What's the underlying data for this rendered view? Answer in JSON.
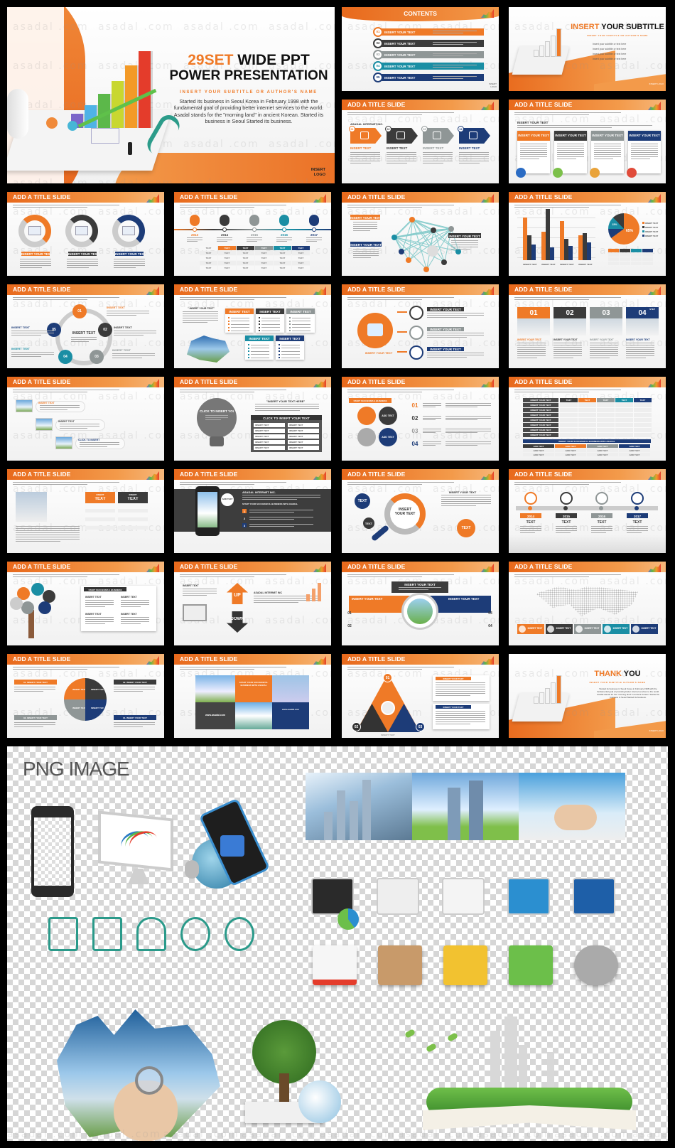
{
  "colors": {
    "orange": "#ef7a27",
    "dark": "#3b3b3b",
    "grey": "#8f9696",
    "teal": "#1a8ea4",
    "navy": "#1d3c78"
  },
  "watermark": "asadal .com",
  "hero": {
    "title_accent": "29SET",
    "title_rest": "WIDE PPT",
    "title_line2": "POWER PRESENTATION",
    "subtitle": "INSERT YOUR SUBTITLE OR AUTHOR'S NAME",
    "body": "Started its business in Seoul Korea in February 1998 with the fundamental goal of providing better internet services to the world. Asadal stands for the \"morning land\" in ancient Korean. Started its business in Seoul Started its business.",
    "logo": "INSERT LOGO"
  },
  "contents": {
    "title": "CONTENTS",
    "items": [
      {
        "num": "01",
        "label": "INSERT YOUR TEXT"
      },
      {
        "num": "02",
        "label": "INSERT YOUR TEXT"
      },
      {
        "num": "03",
        "label": "INSERT YOUR TEXT"
      },
      {
        "num": "04",
        "label": "INSERT YOUR TEXT"
      },
      {
        "num": "05",
        "label": "INSERT YOUR TEXT"
      }
    ],
    "logo": "INSERT LOGO"
  },
  "subtitle_slide": {
    "title_accent": "INSERT",
    "title_rest": "YOUR SUBTITLE",
    "subtitle": "INSERT YOUR SUBTITLE OR AUTHOR'S NAME",
    "bullets": [
      "Insert your subtitle or text here",
      "Insert your subtitle or text here",
      "Insert your subtitle or text here",
      "Insert your subtitle or text here"
    ],
    "logo": "INSERT LOGO"
  },
  "thanks": {
    "title_accent": "THANK",
    "title_rest": "YOU",
    "subtitle": "INSERT YOUR SUBTITLE AUTHOR'S NAME",
    "body": "Started its business in Seoul Korea in February 1998 with the fundamental goal of providing better internet services to the world. Asadal stands for the \"morning land\" in ancient Korean. Started its business in Seoul Started its business.",
    "logo": "INSERT LOGO"
  },
  "slides": [
    {
      "title": "ADD A TITLE SLIDE",
      "variant": "arrows4",
      "labels": [
        "ASADAL INTERNET,INC.",
        "INSERT TEXT",
        "INSERT TEXT",
        "INSERT TEXT",
        "INSERT TEXT",
        "01",
        "02",
        "03",
        "04"
      ]
    },
    {
      "title": "ADD A TITLE SLIDE",
      "variant": "cards4",
      "labels": [
        "INSERT YOUR TEXT",
        "INSERT YOUR TEXT",
        "INSERT YOUR TEXT",
        "INSERT YOUR TEXT",
        "INSERT YOUR TEXT"
      ]
    },
    {
      "title": "ADD A TITLE SLIDE",
      "variant": "donuts3",
      "labels": [
        "INSERT YOUR TEXT",
        "INSERT YOUR TEXT",
        "INSERT YOUR TEXT"
      ]
    },
    {
      "title": "ADD A TITLE SLIDE",
      "variant": "timeline",
      "labels": [
        "2013",
        "2014",
        "2015",
        "2016",
        "2017",
        "TEXT"
      ]
    },
    {
      "title": "ADD A TITLE SLIDE",
      "variant": "network",
      "labels": [
        "INSERT YOUR TEXT",
        "INSERT YOUR TEXT",
        "INSERT YOUR TEXT"
      ]
    },
    {
      "title": "ADD A TITLE SLIDE",
      "variant": "barpie",
      "labels": [
        "INSERT TEXT",
        "INSERT TEXT",
        "INSERT TEXT",
        "INSERT TEXT",
        "65%",
        "15%",
        "INSERT TEXT"
      ]
    },
    {
      "title": "ADD A TITLE SLIDE",
      "variant": "cycle",
      "labels": [
        "INSERT TEXT",
        "01",
        "02",
        "03",
        "04",
        "05",
        "INSERT TEXT"
      ]
    },
    {
      "title": "ADD A TITLE SLIDE",
      "variant": "lists",
      "labels": [
        "INSERT TEXT",
        "INSERT TEXT",
        "INSERT TEXT",
        "INSERT TEXT",
        "INSERT TEXT",
        "\" INSERT YOUR TEXT\"",
        "INSERT YOUR TEXT"
      ]
    },
    {
      "title": "ADD A TITLE SLIDE",
      "variant": "hub",
      "labels": [
        "INSERT YOUR TEXT",
        "INSERT YOUR TEXT",
        "INSERT YOUR TEXT",
        "INSERT YOUR TEXT"
      ]
    },
    {
      "title": "ADD A TITLE SLIDE",
      "variant": "photos4",
      "labels": [
        "01",
        "02",
        "03",
        "04",
        "STEP",
        "INSERT YOUR TEXT"
      ]
    },
    {
      "title": "ADD A TITLE SLIDE",
      "variant": "imglist",
      "labels": [
        "INSERT TEXT",
        "INSERT TEXT",
        "CLICK TO INSERT"
      ]
    },
    {
      "title": "ADD A TITLE SLIDE",
      "variant": "bulb",
      "labels": [
        "CLICK TO INSERT YOUR TEXT",
        "\"INSERT YOUR TEXT HERE\"",
        "CLICK TO INSERT YOUR TEXT",
        "INSERT TEXT"
      ]
    },
    {
      "title": "ADD A TITLE SLIDE",
      "variant": "steps4",
      "labels": [
        "START SUCCESSFUL BUSINESS",
        "01",
        "02",
        "03",
        "04",
        "ADD TEXT",
        "ADD TEXT"
      ]
    },
    {
      "title": "ADD A TITLE SLIDE",
      "variant": "table",
      "labels": [
        "INSERT YOUR TEXT",
        "TEXT",
        "INSERT YOUR SUCCESSFUL BUSINESS WITH ASADAL",
        "ADD TEXT"
      ]
    },
    {
      "title": "ADD A TITLE SLIDE",
      "variant": "phototext",
      "labels": [
        "TEXT",
        "TEXT",
        "INSERT",
        "TEXT"
      ]
    },
    {
      "title": "ADD A TITLE SLIDE",
      "variant": "phone",
      "labels": [
        "ASADAL INTERNET INC.",
        "START YOUR SUCCESSFUL BUSINESS WITH ASADAL",
        "ADD TEXT",
        "1",
        "2",
        "3"
      ]
    },
    {
      "title": "ADD A TITLE SLIDE",
      "variant": "magnifier",
      "labels": [
        "INSERT YOUR TEXT",
        "INSERT YOUR TEXT",
        "TEXT",
        "TEXT",
        "INSERT YOUR TEXT"
      ]
    },
    {
      "title": "ADD A TITLE SLIDE",
      "variant": "timeline2",
      "labels": [
        "2014",
        "2015",
        "2016",
        "2017",
        "TEXT"
      ]
    },
    {
      "title": "ADD A TITLE SLIDE",
      "variant": "tree",
      "labels": [
        "START SUCCESSFUL BUSINESS",
        "INSERT TEXT",
        "INSERT TEXT",
        "INSERT TEXT",
        "INSERT TEXT"
      ]
    },
    {
      "title": "ADD A TITLE SLIDE",
      "variant": "updown",
      "labels": [
        "UP",
        "DOWN",
        "ASADAL INTERNET INC",
        "INSERT TEXT"
      ]
    },
    {
      "title": "ADD A TITLE SLIDE",
      "variant": "ribbon",
      "labels": [
        "INSERT YOUR TEXT",
        "INSERT YOUR TEXT",
        "INSERT YOUR TEXT",
        "01",
        "02",
        "03",
        "04"
      ]
    },
    {
      "title": "ADD A TITLE SLIDE",
      "variant": "map",
      "labels": [
        "INSERT TEXT",
        "INSERT TEXT",
        "INSERT TEXT",
        "INSERT TEXT",
        "INSERT TEXT"
      ]
    },
    {
      "title": "ADD A TITLE SLIDE",
      "variant": "quad",
      "labels": [
        "01. INSERT YOUR TEXT",
        "02. INSERT YOUR TEXT",
        "03. INSERT YOUR TEXT",
        "04. INSERT YOUR TEXT",
        "INSERT TEXT"
      ]
    },
    {
      "title": "ADD A TITLE SLIDE",
      "variant": "grid",
      "labels": [
        "START YOUR SUCCESSFUL BUSINESS WITH ASADAL",
        "www.asadal.com",
        "www.asadal.com"
      ]
    },
    {
      "title": "ADD A TITLE SLIDE",
      "variant": "triangle",
      "labels": [
        "01",
        "02",
        "03",
        "INSERT YOUR TEXT",
        "INSERT YOUR TEXT",
        "INSERT TEXT"
      ]
    }
  ],
  "png_panel": {
    "title": "PNG IMAGE",
    "icons": [
      "browser-icon",
      "mobile-user-icon",
      "cloud-sync-icon",
      "eco-globe-icon",
      "search-question-icon"
    ]
  }
}
